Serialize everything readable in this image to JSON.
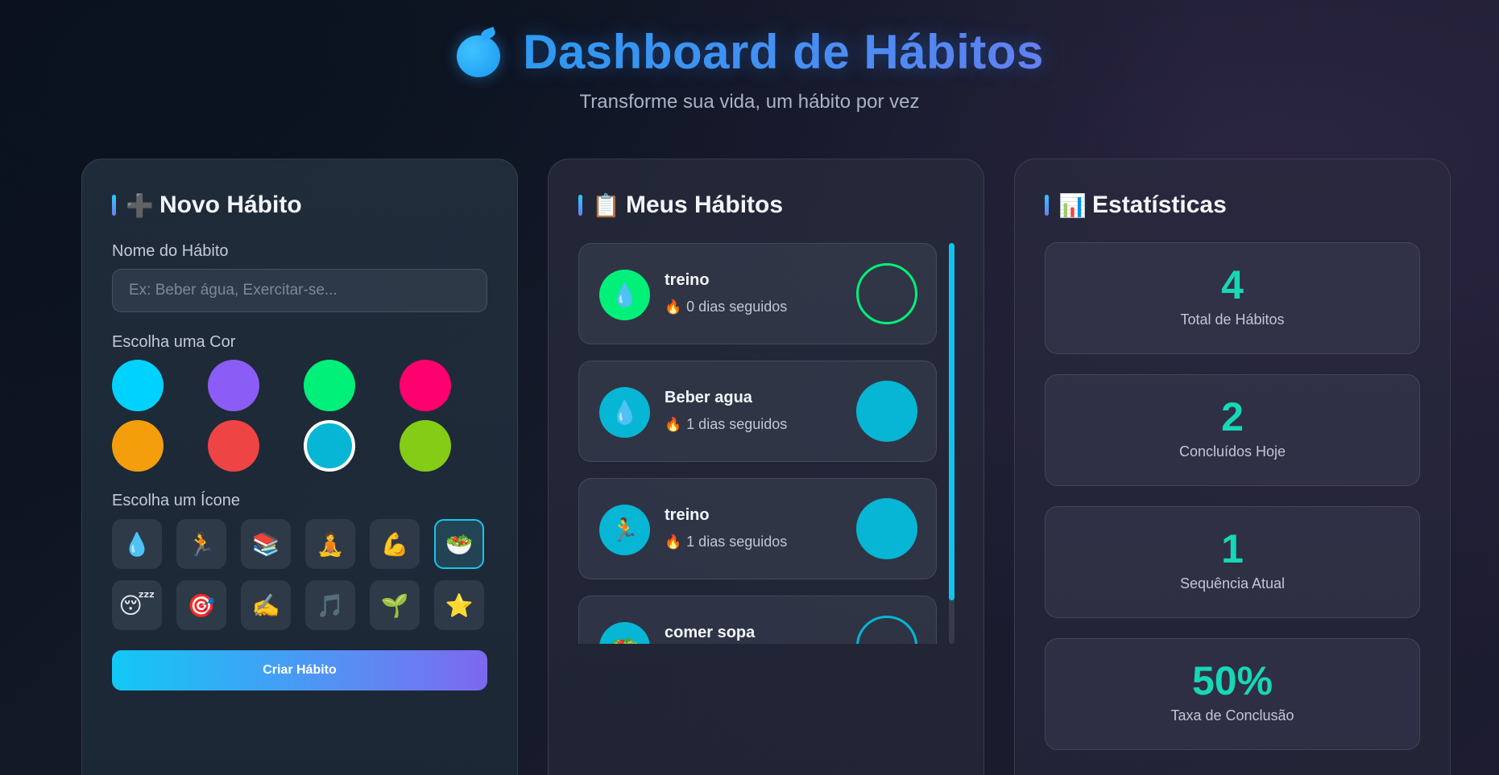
{
  "header": {
    "title": "Dashboard de Hábitos",
    "subtitle": "Transforme sua vida, um hábito por vez"
  },
  "new_habit": {
    "title_icon": "➕",
    "title": "Novo Hábito",
    "name_label": "Nome do Hábito",
    "name_placeholder": "Ex: Beber água, Exercitar-se...",
    "name_value": "",
    "color_label": "Escolha uma Cor",
    "colors": [
      "#00d2ff",
      "#8b5cf6",
      "#00f07a",
      "#ff006e",
      "#f59e0b",
      "#ef4444",
      "#06b6d4",
      "#84cc16"
    ],
    "selected_color_index": 6,
    "icon_label": "Escolha um Ícone",
    "icons": [
      "💧",
      "🏃",
      "📚",
      "🧘",
      "💪",
      "🥗",
      "😴",
      "🎯",
      "✍️",
      "🎵",
      "🌱",
      "⭐"
    ],
    "selected_icon_index": 5,
    "create_button": "Criar Hábito"
  },
  "habits": {
    "title_icon": "📋",
    "title": "Meus Hábitos",
    "items": [
      {
        "name": "treino",
        "icon": "💧",
        "color": "#00f07a",
        "streak": "0 dias seguidos",
        "done": false
      },
      {
        "name": "Beber agua",
        "icon": "💧",
        "color": "#06b6d4",
        "streak": "1 dias seguidos",
        "done": true
      },
      {
        "name": "treino",
        "icon": "🏃",
        "color": "#06b6d4",
        "streak": "1 dias seguidos",
        "done": true
      },
      {
        "name": "comer sopa",
        "icon": "🥗",
        "color": "#06b6d4",
        "streak": "",
        "done": false
      }
    ],
    "flame_icon": "🔥"
  },
  "stats": {
    "title_icon": "📊",
    "title": "Estatísticas",
    "cards": [
      {
        "value": "4",
        "label": "Total de Hábitos"
      },
      {
        "value": "2",
        "label": "Concluídos Hoje"
      },
      {
        "value": "1",
        "label": "Sequência Atual"
      },
      {
        "value": "50%",
        "label": "Taxa de Conclusão"
      }
    ]
  }
}
